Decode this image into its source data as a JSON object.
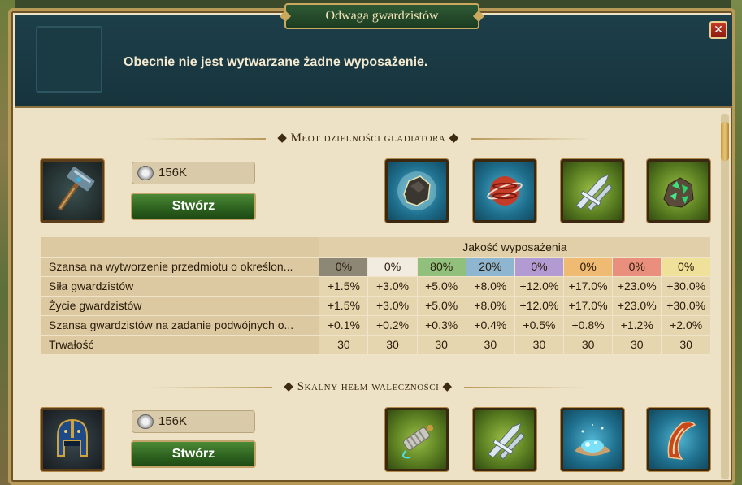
{
  "window": {
    "title": "Odwaga gwardzistów",
    "close_label": "✕",
    "message": "Obecnie nie jest wytwarzane żadne wyposażenie."
  },
  "sections": [
    {
      "title": "Młot dzielności gladiatora",
      "item_icon": "war-hammer-icon",
      "cost": "156K",
      "create_label": "Stwórz",
      "materials": [
        "stone-ore-icon",
        "red-orb-icon",
        "crossed-blades-icon",
        "green-crystal-ore-icon"
      ]
    },
    {
      "title": "Skalny hełm waleczności",
      "item_icon": "gladiator-helmet-icon",
      "cost": "156K",
      "create_label": "Stwórz",
      "materials": [
        "spring-coil-icon",
        "crossed-blades-icon",
        "blue-crystal-pile-icon",
        "claw-horn-icon"
      ]
    }
  ],
  "table": {
    "header": "Jakość wyposażenia",
    "rows": [
      {
        "label": "Szansa na wytworzenie przedmiotu o określon...",
        "values": [
          "0%",
          "0%",
          "80%",
          "20%",
          "0%",
          "0%",
          "0%",
          "0%"
        ]
      },
      {
        "label": "Siła gwardzistów",
        "values": [
          "+1.5%",
          "+3.0%",
          "+5.0%",
          "+8.0%",
          "+12.0%",
          "+17.0%",
          "+23.0%",
          "+30.0%"
        ]
      },
      {
        "label": "Życie gwardzistów",
        "values": [
          "+1.5%",
          "+3.0%",
          "+5.0%",
          "+8.0%",
          "+12.0%",
          "+17.0%",
          "+23.0%",
          "+30.0%"
        ]
      },
      {
        "label": "Szansa gwardzistów na zadanie podwójnych o...",
        "values": [
          "+0.1%",
          "+0.2%",
          "+0.3%",
          "+0.4%",
          "+0.5%",
          "+0.8%",
          "+1.2%",
          "+2.0%"
        ]
      },
      {
        "label": "Trwałość",
        "values": [
          "30",
          "30",
          "30",
          "30",
          "30",
          "30",
          "30",
          "30"
        ]
      }
    ],
    "quality_colors": [
      "#8d8876",
      "#f2ece0",
      "#91c07c",
      "#8eb6d1",
      "#b29bd2",
      "#efba72",
      "#ea8f7d",
      "#f0e19a"
    ]
  }
}
